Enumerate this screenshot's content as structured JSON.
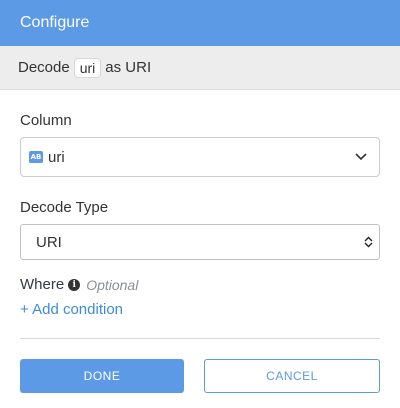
{
  "header": {
    "title": "Configure"
  },
  "subheader": {
    "prefix": "Decode",
    "column_chip": "uri",
    "suffix": "as URI"
  },
  "column": {
    "label": "Column",
    "type_badge": "AB",
    "value": "uri"
  },
  "decode_type": {
    "label": "Decode Type",
    "value": "URI"
  },
  "where": {
    "label": "Where",
    "optional": "Optional",
    "add_condition": "+ Add condition"
  },
  "buttons": {
    "done": "DONE",
    "cancel": "CANCEL"
  },
  "colors": {
    "accent": "#5c9ae6",
    "link": "#3d8bdb"
  },
  "icons": {
    "column_type": "string-type-icon",
    "dropdown": "chevron-down-icon",
    "info": "info-icon"
  }
}
